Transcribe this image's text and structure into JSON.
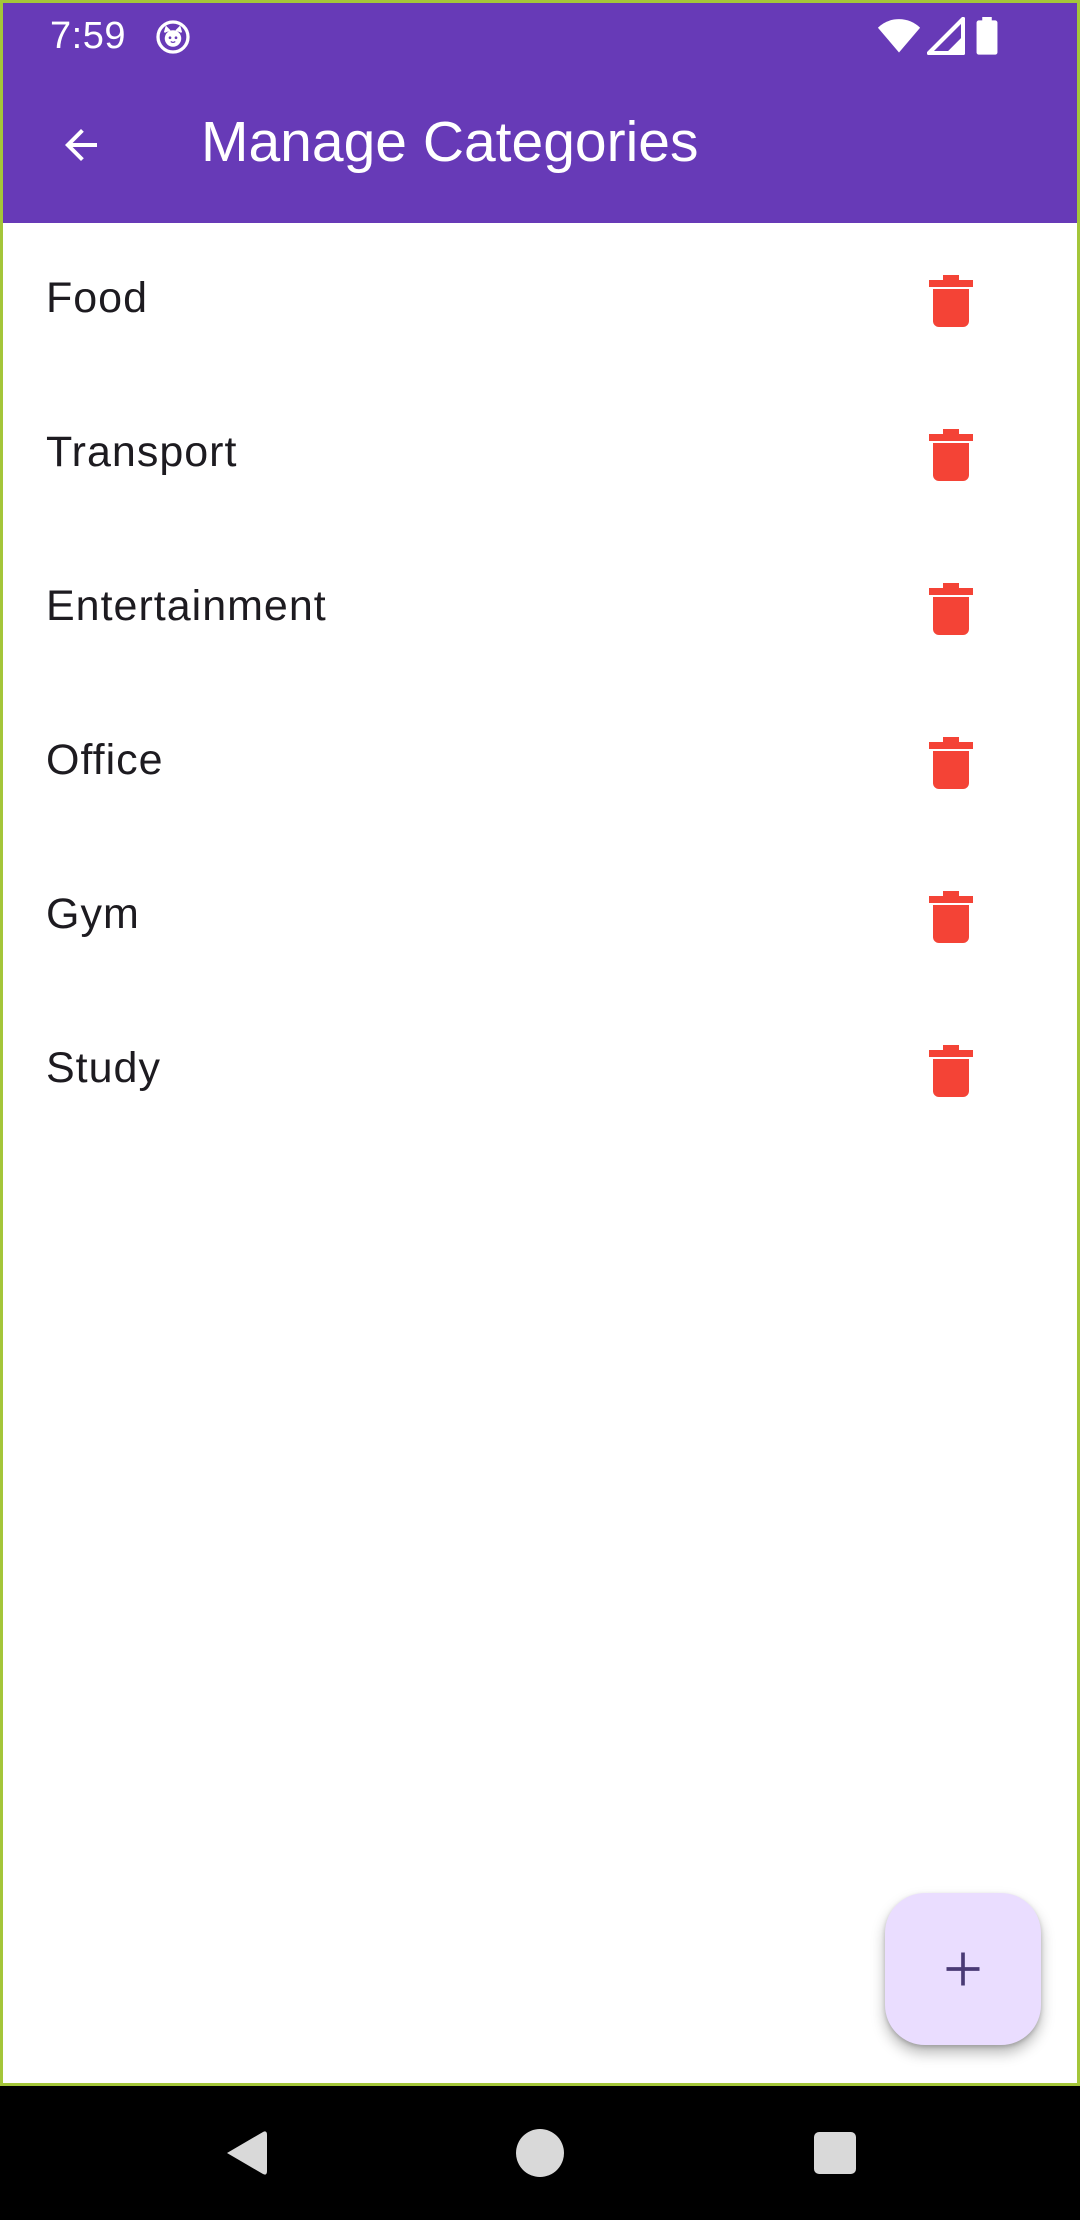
{
  "status_bar": {
    "time": "7:59",
    "icons": [
      "cat-face-icon",
      "wifi-icon",
      "cell-signal-icon",
      "battery-icon"
    ]
  },
  "app_bar": {
    "back_icon": "arrow-left-icon",
    "title": "Manage Categories",
    "background_color": "#673ab7"
  },
  "categories": [
    {
      "label": "Food",
      "action_icon": "trash-icon"
    },
    {
      "label": "Transport",
      "action_icon": "trash-icon"
    },
    {
      "label": "Entertainment",
      "action_icon": "trash-icon"
    },
    {
      "label": "Office",
      "action_icon": "trash-icon"
    },
    {
      "label": "Gym",
      "action_icon": "trash-icon"
    },
    {
      "label": "Study",
      "action_icon": "trash-icon"
    }
  ],
  "delete_color": "#f44336",
  "fab": {
    "icon": "plus-icon",
    "background_color": "#eaddff"
  },
  "nav_bar": {
    "icons": [
      "back-triangle-icon",
      "home-circle-icon",
      "recents-square-icon"
    ]
  }
}
